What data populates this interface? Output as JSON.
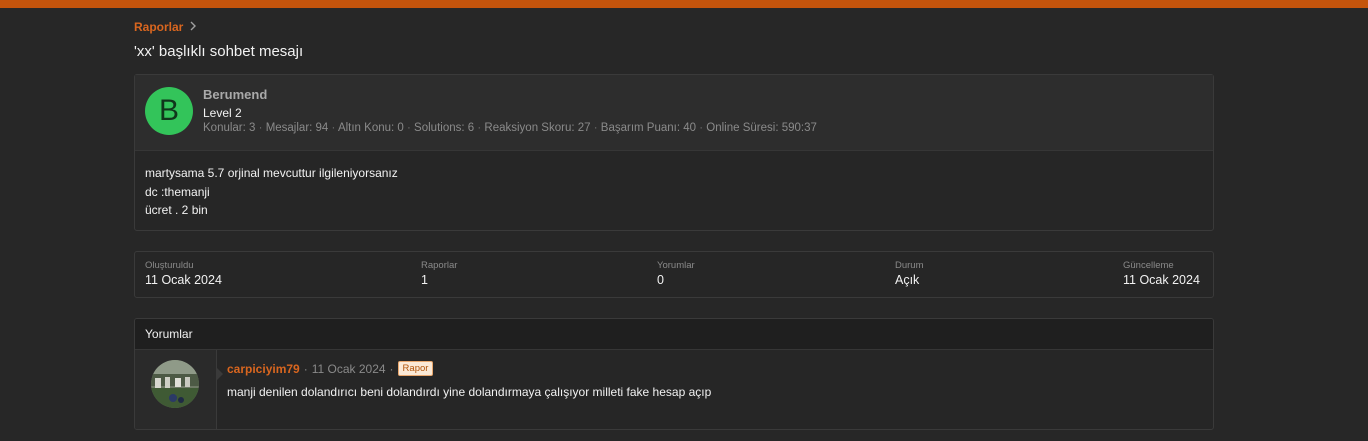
{
  "breadcrumb": {
    "label": "Raporlar",
    "chevron": "chevron-right-icon"
  },
  "page": {
    "title": "'xx' başlıklı sohbet mesajı"
  },
  "reported_content": {
    "user": {
      "avatar_letter": "B",
      "avatar_color": "#33c45a",
      "name": "Berumend",
      "level": "Level 2",
      "stats": [
        "Konular: 3",
        "Mesajlar: 94",
        "Altın Konu: 0",
        "Solutions: 6",
        "Reaksiyon Skoru: 27",
        "Başarım Puanı: 40",
        "Online Süresi: 590:37"
      ],
      "stat_separator": "·"
    },
    "body_lines": [
      "martysama 5.7 orjinal mevcuttur ilgileniyorsanız",
      "dc :themanji",
      "ücret . 2 bin"
    ]
  },
  "info": {
    "created": {
      "label": "Oluşturuldu",
      "value": "11 Ocak 2024"
    },
    "reports": {
      "label": "Raporlar",
      "value": "1"
    },
    "comments": {
      "label": "Yorumlar",
      "value": "0"
    },
    "status": {
      "label": "Durum",
      "value": "Açık"
    },
    "updated": {
      "label": "Güncelleme",
      "value": "11 Ocak 2024"
    }
  },
  "comments_section": {
    "title": "Yorumlar",
    "items": [
      {
        "author": "carpiciyim79",
        "separator": "·",
        "date": "11 Ocak 2024",
        "badge": "Rapor",
        "text": "manji denilen dolandırıcı beni dolandırdı yine dolandırmaya çalışıyor milleti fake hesap açıp"
      }
    ]
  },
  "colors": {
    "accent": "#c4540c",
    "link": "#d9661f",
    "background": "#272727"
  }
}
